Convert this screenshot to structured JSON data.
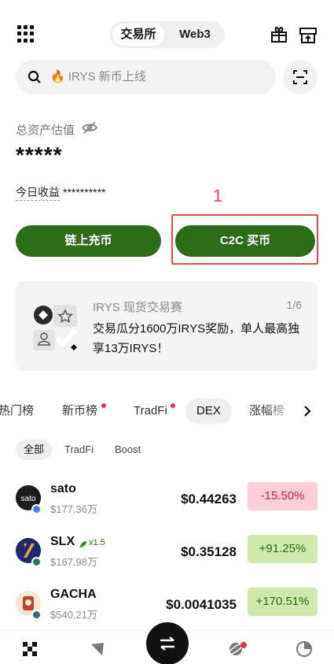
{
  "header": {
    "tabs": [
      "交易所",
      "Web3"
    ],
    "icons": [
      "grid-menu-icon",
      "gift-icon",
      "store-icon"
    ]
  },
  "search": {
    "placeholder": "🔥 IRYS 新币上线",
    "icon": "search-icon",
    "scan_icon": "scan-icon"
  },
  "assets": {
    "label": "总资产估值",
    "value": "*****",
    "today_label": "今日收益",
    "today_value": "**********",
    "eye_icon": "eye-off-icon"
  },
  "annotation": {
    "marker": "1",
    "color": "#e34a4a"
  },
  "actions": {
    "deposit": "链上充币",
    "c2c": "C2C 买币",
    "accent": "#2c6e18"
  },
  "promo": {
    "title": "IRYS 现货交易赛",
    "count": "1/6",
    "body": "交易瓜分1600万IRYS奖励，单人最高独享13万IRYS！"
  },
  "tabs": [
    "热门榜",
    "新币榜",
    "TradFi",
    "DEX",
    "涨幅榜"
  ],
  "active_tab": "DEX",
  "subtabs": [
    "全部",
    "TradFi",
    "Boost"
  ],
  "rows": [
    {
      "symbol": "sato",
      "volume": "$177.36万",
      "price": "$0.44263",
      "change": "-15.50%",
      "direction": "down"
    },
    {
      "symbol": "SLX",
      "boost": "x1.5",
      "volume": "$167.98万",
      "price": "$0.35128",
      "change": "+91.25%",
      "direction": "up"
    },
    {
      "symbol": "GACHA",
      "volume": "$540.21万",
      "price": "$0.0041035",
      "change": "+170.51%",
      "direction": "up"
    }
  ],
  "colors": {
    "down_bg": "#fbcdd6",
    "down_text": "#c5283d",
    "up_bg": "#cfe8ae",
    "up_text": "#2d6a11"
  },
  "bottom_nav": [
    "home-icon",
    "explore-icon",
    "trade-icon",
    "earn-icon",
    "assets-icon"
  ]
}
